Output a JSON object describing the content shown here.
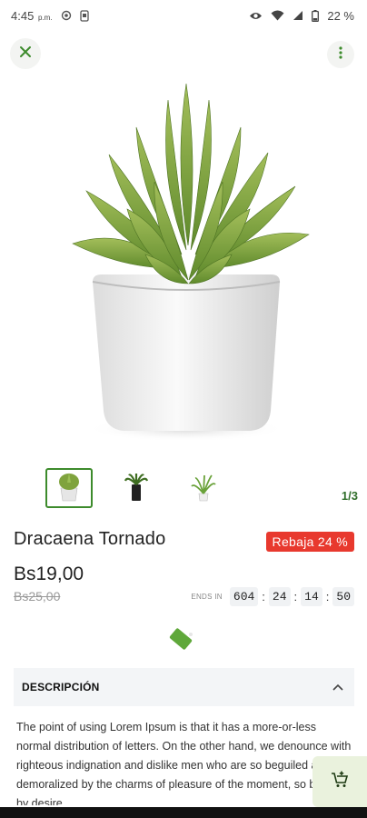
{
  "status_bar": {
    "time": "4:45",
    "ampm": "p.m.",
    "battery_percent": "22 %",
    "icons": [
      "location-icon",
      "notification-icon",
      "eye-icon",
      "wifi-icon",
      "signal-icon",
      "battery-icon"
    ]
  },
  "header": {
    "close_icon": "close-icon",
    "menu_icon": "more-vert-icon"
  },
  "gallery": {
    "pager": "1/3",
    "active_index": 0,
    "thumbnails": [
      "plant-thumb-1",
      "plant-thumb-2",
      "plant-thumb-3"
    ]
  },
  "product": {
    "name": "Dracaena Tornado",
    "discount_label": "Rebaja 24 %",
    "price": "Bs19,00",
    "old_price": "Bs25,00"
  },
  "countdown": {
    "label": "ENDS IN",
    "days": "604",
    "hours": "24",
    "minutes": "14",
    "seconds": "50"
  },
  "description": {
    "title": "DESCRIPCIÓN",
    "text": "The point of using Lorem Ipsum is that it has a more-or-less normal distribution of letters. On the other hand, we denounce with righteous indignation and dislike men who are so beguiled and demoralized by the charms of pleasure of the moment, so blinded by desire"
  },
  "colors": {
    "accent_green": "#3d8b2c",
    "discount_red": "#e8392e",
    "cart_bg": "#eaf2dd"
  }
}
